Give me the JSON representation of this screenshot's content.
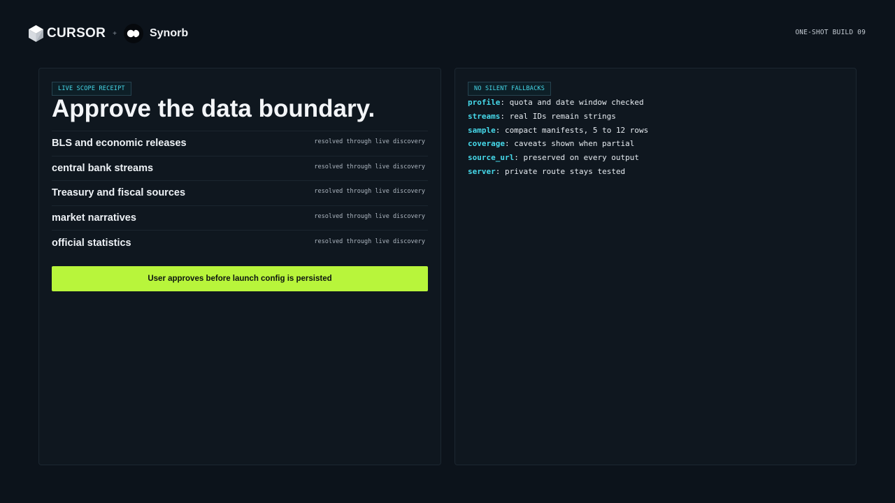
{
  "header": {
    "cursor_brand": "CURSOR",
    "plus_sign": "+",
    "synorb_brand": "Synorb",
    "build_label": "ONE-SHOT BUILD 09"
  },
  "left_panel": {
    "tag": "LIVE SCOPE RECEIPT",
    "headline": "Approve the data boundary.",
    "scope_rows": [
      {
        "name": "BLS and economic releases",
        "status": "resolved through live discovery"
      },
      {
        "name": "central bank streams",
        "status": "resolved through live discovery"
      },
      {
        "name": "Treasury and fiscal sources",
        "status": "resolved through live discovery"
      },
      {
        "name": "market narratives",
        "status": "resolved through live discovery"
      },
      {
        "name": "official statistics",
        "status": "resolved through live discovery"
      }
    ],
    "approve_button": "User approves before launch config is persisted"
  },
  "right_panel": {
    "tag": "NO SILENT FALLBACKS",
    "items": [
      {
        "key": "profile",
        "value": " quota and date window checked"
      },
      {
        "key": "streams",
        "value": " real IDs remain strings"
      },
      {
        "key": "sample",
        "value": " compact manifests, 5 to 12 rows"
      },
      {
        "key": "coverage",
        "value": " caveats shown when partial"
      },
      {
        "key": "source_url",
        "value": " preserved on every output"
      },
      {
        "key": "server",
        "value": " private route stays tested"
      }
    ]
  },
  "icons": {
    "cursor_logo": "cube-logo-icon",
    "synorb_logo": "synorb-orb-icon"
  },
  "colors": {
    "background": "#0c131b",
    "panel": "#0f171f",
    "accent_cyan": "#46d9ea",
    "accent_lime": "#b8f53b"
  }
}
